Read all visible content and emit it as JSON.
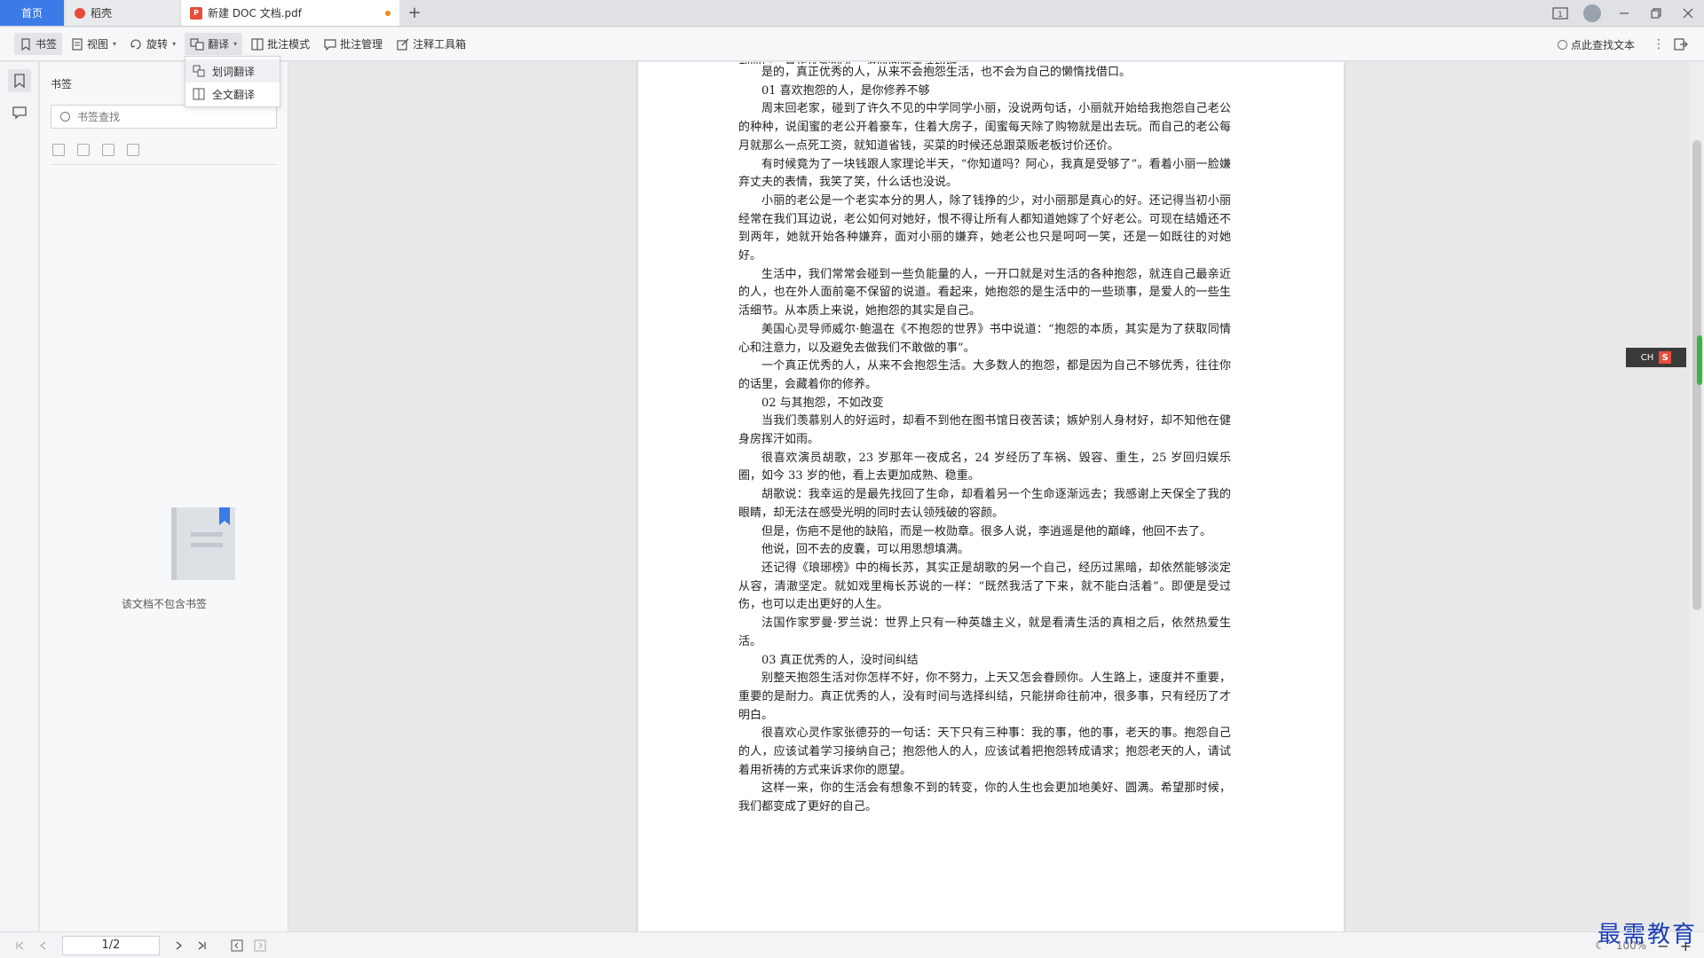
{
  "tabs": {
    "home": "首页",
    "daoke": "稻壳",
    "doc": "新建 DOC 文档.pdf",
    "add": "+"
  },
  "window": {
    "user_badge": "1"
  },
  "toolbar": {
    "bookmark": "书签",
    "view": "视图",
    "rotate": "旋转",
    "translate": "翻译",
    "annotate_mode": "批注模式",
    "annotate_manage": "批注管理",
    "annotate_tools": "注释工具箱",
    "find_text": "点此查找文本"
  },
  "dropdown": {
    "word_translate": "划词翻译",
    "full_translate": "全文翻译"
  },
  "bookmark_panel": {
    "title": "书签",
    "search_placeholder": "书签查找",
    "empty_text": "该文档不包含书签"
  },
  "document": {
    "paragraphs": [
      {
        "cls": "cut",
        "text": "到而已。真正优秀的人，没时间跟生活纠缠。"
      },
      {
        "cls": "",
        "text": "是的，真正优秀的人，从来不会抱怨生活，也不会为自己的懒惰找借口。"
      },
      {
        "cls": "h",
        "text": "01 喜欢抱怨的人，是你修养不够"
      },
      {
        "cls": "",
        "text": "周末回老家，碰到了许久不见的中学同学小丽，没说两句话，小丽就开始给我抱怨自己老公的种种，说闺蜜的老公开着豪车，住着大房子，闺蜜每天除了购物就是出去玩。而自己的老公每月就那么一点死工资，就知道省钱，买菜的时候还总跟菜贩老板讨价还价。"
      },
      {
        "cls": "",
        "text": "有时候竟为了一块钱跟人家理论半天，“你知道吗？阿心，我真是受够了”。看着小丽一脸嫌弃丈夫的表情，我笑了笑，什么话也没说。"
      },
      {
        "cls": "",
        "text": "小丽的老公是一个老实本分的男人，除了钱挣的少，对小丽那是真心的好。还记得当初小丽经常在我们耳边说，老公如何对她好，恨不得让所有人都知道她嫁了个好老公。可现在结婚还不到两年，她就开始各种嫌弃，面对小丽的嫌弃，她老公也只是呵呵一笑，还是一如既往的对她好。"
      },
      {
        "cls": "",
        "text": "生活中，我们常常会碰到一些负能量的人，一开口就是对生活的各种抱怨，就连自己最亲近的人，也在外人面前毫不保留的说道。看起来，她抱怨的是生活中的一些琐事，是爱人的一些生活细节。从本质上来说，她抱怨的其实是自己。"
      },
      {
        "cls": "",
        "text": "美国心灵导师威尔·鲍温在《不抱怨的世界》书中说道：“抱怨的本质，其实是为了获取同情心和注意力，以及避免去做我们不敢做的事”。"
      },
      {
        "cls": "",
        "text": "一个真正优秀的人，从来不会抱怨生活。大多数人的抱怨，都是因为自己不够优秀，往往你的话里，会藏着你的修养。"
      },
      {
        "cls": "h",
        "text": "02 与其抱怨，不如改变"
      },
      {
        "cls": "",
        "text": "当我们羡慕别人的好运时，却看不到他在图书馆日夜苦读；嫉妒别人身材好，却不知他在健身房挥汗如雨。"
      },
      {
        "cls": "",
        "text": "很喜欢演员胡歌，23 岁那年一夜成名，24 岁经历了车祸、毁容、重生，25 岁回归娱乐圈，如今 33 岁的他，看上去更加成熟、稳重。"
      },
      {
        "cls": "",
        "text": "胡歌说：我幸运的是最先找回了生命，却看着另一个生命逐渐远去；我感谢上天保全了我的眼睛，却无法在感受光明的同时去认领残破的容颜。"
      },
      {
        "cls": "",
        "text": "但是，伤疤不是他的缺陷，而是一枚勋章。很多人说，李逍遥是他的巅峰，他回不去了。"
      },
      {
        "cls": "",
        "text": "他说，回不去的皮囊，可以用思想填满。"
      },
      {
        "cls": "",
        "text": "还记得《琅琊榜》中的梅长苏，其实正是胡歌的另一个自己，经历过黑暗，却依然能够淡定从容，清澈坚定。就如戏里梅长苏说的一样：“既然我活了下来，就不能白活着”。即便是受过伤，也可以走出更好的人生。"
      },
      {
        "cls": "",
        "text": "法国作家罗曼·罗兰说：世界上只有一种英雄主义，就是看清生活的真相之后，依然热爱生活。"
      },
      {
        "cls": "h",
        "text": "03 真正优秀的人，没时间纠结"
      },
      {
        "cls": "",
        "text": "别整天抱怨生活对你怎样不好，你不努力，上天又怎会眷顾你。人生路上，速度并不重要，重要的是耐力。真正优秀的人，没有时间与选择纠结，只能拼命往前冲，很多事，只有经历了才明白。"
      },
      {
        "cls": "",
        "text": "很喜欢心灵作家张德芬的一句话：天下只有三种事：我的事，他的事，老天的事。抱怨自己的人，应该试着学习接纳自己；抱怨他人的人，应该试着把抱怨转成请求；抱怨老天的人，请试着用祈祷的方式来诉求你的愿望。"
      },
      {
        "cls": "",
        "text": "这样一来，你的生活会有想象不到的转变，你的人生也会更加地美好、圆满。希望那时候，我们都变成了更好的自己。"
      }
    ]
  },
  "ime": {
    "label": "CH",
    "logo": "S"
  },
  "statusbar": {
    "page_value": "1/2",
    "zoom": "100%"
  },
  "watermark": "最需教育",
  "colors": {
    "accent": "#3b7be8",
    "pdf_red": "#e84d3c",
    "watermark_blue": "#1b3fb5"
  }
}
